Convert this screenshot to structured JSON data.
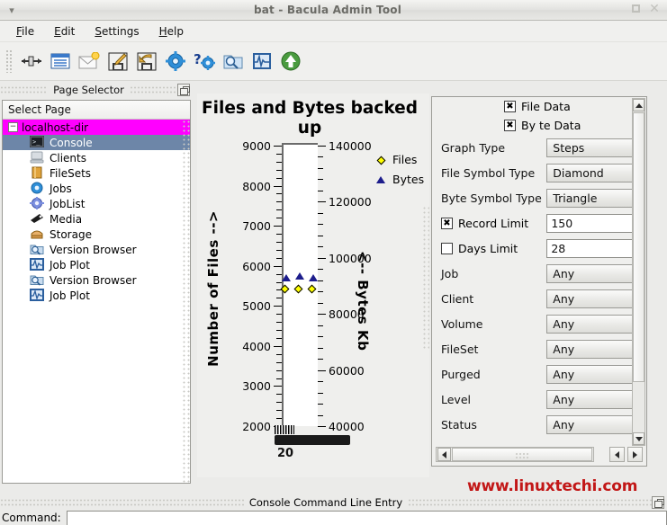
{
  "window": {
    "title": "bat - Bacula Admin Tool",
    "restore_label": "restore",
    "close_label": "close"
  },
  "menubar": {
    "items": [
      {
        "label": "File",
        "accel": "F"
      },
      {
        "label": "Edit",
        "accel": "E"
      },
      {
        "label": "Settings",
        "accel": "S"
      },
      {
        "label": "Help",
        "accel": "H"
      }
    ]
  },
  "toolbar": {
    "buttons": [
      {
        "name": "connect-icon",
        "tip": "Connect"
      },
      {
        "name": "list-icon",
        "tip": "List"
      },
      {
        "name": "mail-icon",
        "tip": "Messages"
      },
      {
        "name": "save-edit-icon",
        "tip": "Edit and Save"
      },
      {
        "name": "save-undo-icon",
        "tip": "Undo and Save"
      },
      {
        "name": "gear-icon",
        "tip": "Run Job"
      },
      {
        "name": "help-gear-icon",
        "tip": "Job Help"
      },
      {
        "name": "browse-icon",
        "tip": "Version Browser"
      },
      {
        "name": "jobplot-icon",
        "tip": "Job Plot"
      },
      {
        "name": "up-arrow-icon",
        "tip": "Estimate"
      }
    ]
  },
  "page_selector": {
    "dock_title": "Page Selector",
    "header": "Select Page",
    "root": {
      "label": "localhost-dir",
      "expanded": true
    },
    "items": [
      {
        "label": "Console",
        "icon": "console-icon",
        "selected": true
      },
      {
        "label": "Clients",
        "icon": "clients-icon",
        "selected": false
      },
      {
        "label": "FileSets",
        "icon": "filesets-icon",
        "selected": false
      },
      {
        "label": "Jobs",
        "icon": "jobs-icon",
        "selected": false
      },
      {
        "label": "JobList",
        "icon": "joblist-icon",
        "selected": false
      },
      {
        "label": "Media",
        "icon": "media-icon",
        "selected": false
      },
      {
        "label": "Storage",
        "icon": "storage-icon",
        "selected": false
      },
      {
        "label": "Version Browser",
        "icon": "version-browser-icon",
        "selected": false
      },
      {
        "label": "Job Plot",
        "icon": "job-plot-icon",
        "selected": false
      },
      {
        "label": "Version Browser",
        "icon": "version-browser-icon",
        "selected": false
      },
      {
        "label": "Job Plot",
        "icon": "job-plot-icon",
        "selected": false
      }
    ]
  },
  "chart_data": {
    "type": "scatter",
    "title": "Files and Bytes backed up",
    "xlabel": "20",
    "ylabel": "Number of Files -->",
    "ylabel_right": "<-- Bytes Kb",
    "grid": false,
    "legend_position": "top-right",
    "yticks_left": [
      2000,
      3000,
      4000,
      5000,
      6000,
      7000,
      8000,
      9000
    ],
    "ylim_left": [
      2000,
      9000
    ],
    "yticks_right": [
      40000,
      60000,
      80000,
      100000,
      120000,
      140000
    ],
    "ylim_right": [
      40000,
      140000
    ],
    "series": [
      {
        "name": "Files",
        "symbol": "Diamond",
        "color": "#ffff00",
        "axis": "left",
        "x": [
          1,
          2,
          3
        ],
        "values": [
          5400,
          5400,
          5400
        ]
      },
      {
        "name": "Bytes",
        "symbol": "Triangle",
        "color": "#1d1d8c",
        "axis": "right",
        "x": [
          1,
          2,
          3
        ],
        "values": [
          93000,
          93500,
          93000
        ]
      }
    ]
  },
  "settings": {
    "checkboxes": [
      {
        "label": "File Data",
        "checked": true
      },
      {
        "label": "By te Data",
        "checked": true
      }
    ],
    "fields": [
      {
        "label": "Graph Type",
        "value": "Steps",
        "type": "combo"
      },
      {
        "label": "File Symbol Type",
        "value": "Diamond",
        "type": "combo"
      },
      {
        "label": "Byte Symbol Type",
        "value": "Triangle",
        "type": "combo"
      }
    ],
    "limits": [
      {
        "label": "Record Limit",
        "value": "150",
        "checked": true
      },
      {
        "label": "Days Limit",
        "value": "28",
        "checked": false
      }
    ],
    "filters": [
      {
        "label": "Job",
        "value": "Any"
      },
      {
        "label": "Client",
        "value": "Any"
      },
      {
        "label": "Volume",
        "value": "Any"
      },
      {
        "label": "FileSet",
        "value": "Any"
      },
      {
        "label": "Purged",
        "value": "Any"
      },
      {
        "label": "Level",
        "value": "Any"
      },
      {
        "label": "Status",
        "value": "Any"
      }
    ]
  },
  "watermark": {
    "text": "www.linuxtechi.com",
    "color": "#c21717"
  },
  "console": {
    "dock_title": "Console Command Line Entry",
    "command_label": "Command:",
    "command_value": "",
    "command_placeholder": ""
  }
}
